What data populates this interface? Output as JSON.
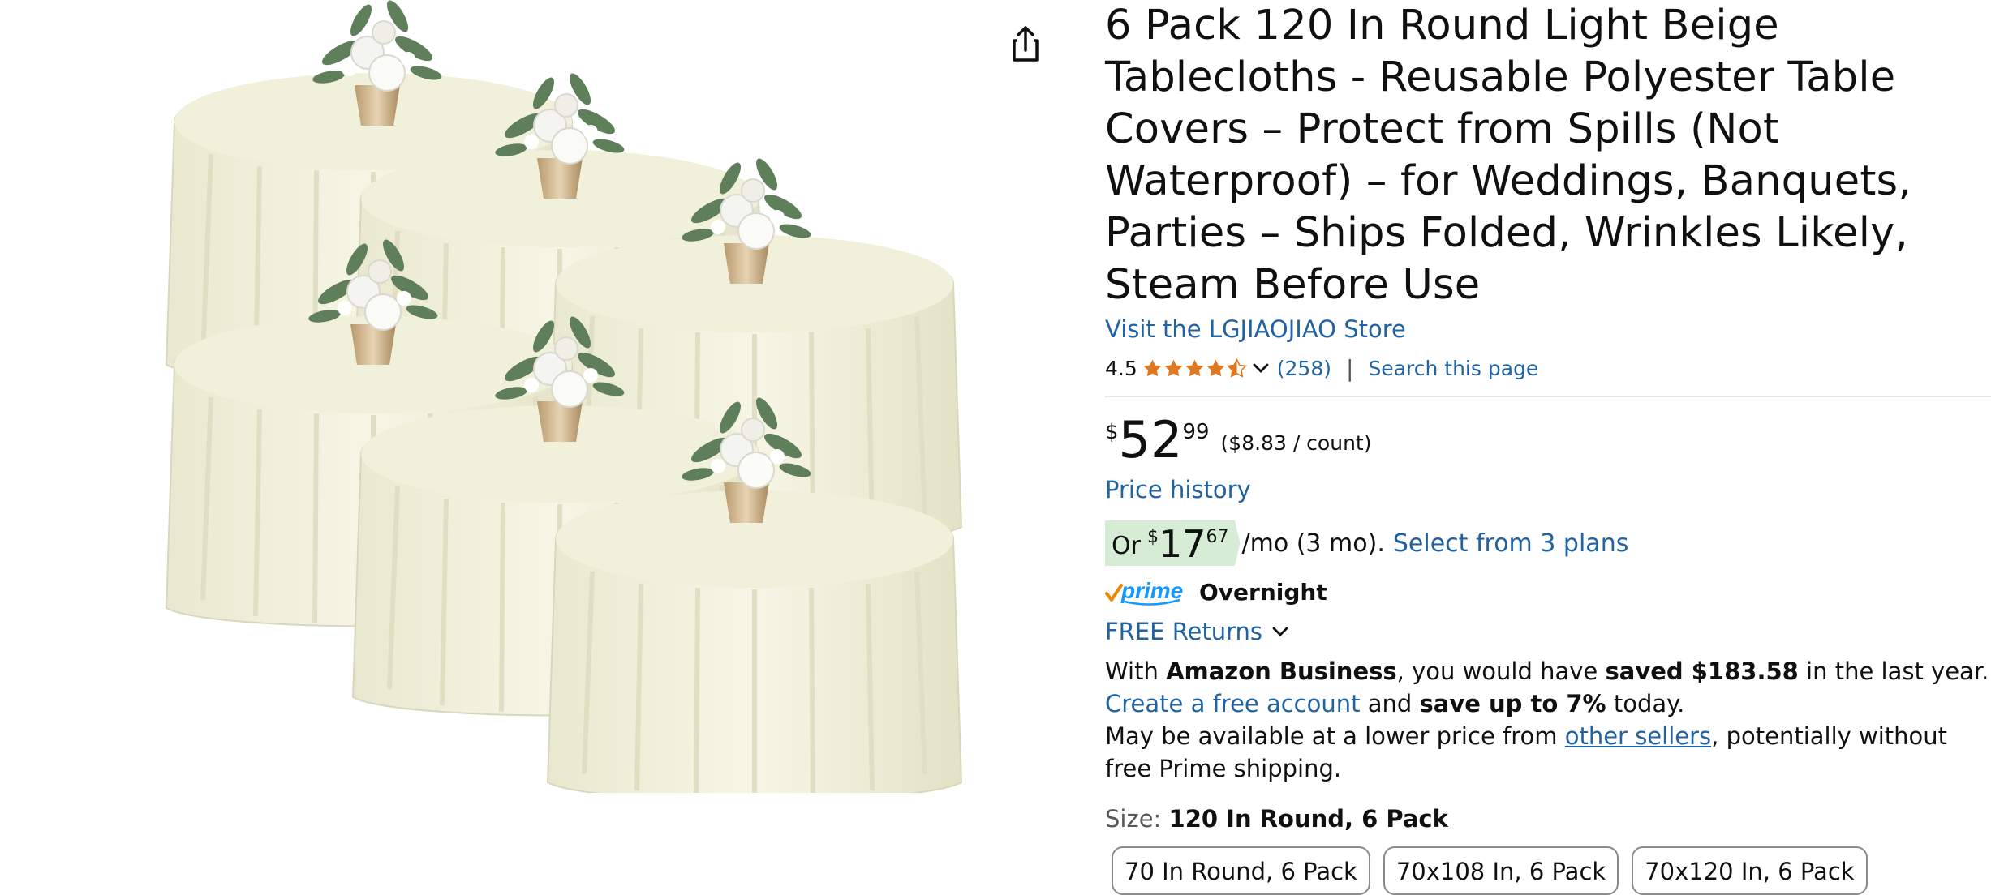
{
  "product": {
    "title": "6 Pack 120 In Round Light Beige Tablecloths - Reusable Polyester Table Covers – Protect from Spills (Not Waterproof) – for Weddings, Banquets, Parties – Ships Folded, Wrinkles Likely, Steam Before Use",
    "store_link": "Visit the LGJIAOJIAO Store",
    "rating_value": "4.5",
    "rating_stars": 4.5,
    "review_count": "(258)",
    "search_page_link": "Search this page"
  },
  "price": {
    "currency": "$",
    "whole": "52",
    "fraction": "99",
    "unit_price": "($8.83 / count)",
    "price_history_link": "Price history"
  },
  "installment": {
    "or_label": "Or",
    "currency": "$",
    "whole": "17",
    "fraction": "67",
    "term": "/mo (3 mo).",
    "plans_link": "Select from 3 plans"
  },
  "delivery": {
    "prime_label": "prime",
    "speed": "Overnight",
    "returns_link": "FREE Returns"
  },
  "business": {
    "text1": "With ",
    "brand": "Amazon Business",
    "text2": ", you would have ",
    "saved": "saved $183.58",
    "text3": " in the last year. ",
    "create_link": "Create a free account",
    "text4": " and ",
    "save_up": "save up to 7%",
    "text5": " today."
  },
  "lower_price": {
    "text1": "May be available at a lower price from ",
    "sellers_link": "other sellers",
    "text2": ", potentially without free Prime shipping."
  },
  "size": {
    "label": "Size:",
    "selected": "120 In Round, 6 Pack",
    "options": [
      "70 In Round, 6 Pack",
      "70x108 In, 6 Pack",
      "70x120 In, 6 Pack"
    ]
  },
  "colors": {
    "link": "#2162a1",
    "star": "#de7921",
    "installment_bg": "#d6ecd5",
    "prime_blue": "#1399ff",
    "tablecloth": "#f2f1dc"
  },
  "icons": [
    "share-icon",
    "star-icon",
    "chevron-down-icon",
    "prime-logo"
  ]
}
